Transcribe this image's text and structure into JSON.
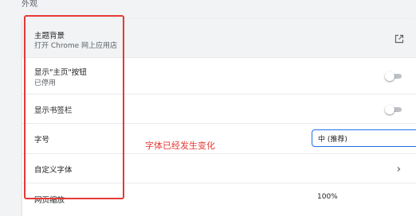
{
  "section": {
    "title": "外观"
  },
  "rows": {
    "theme": {
      "label": "主题背景",
      "sub": "打开 Chrome 网上应用店",
      "icon": "external-link-icon"
    },
    "home_button": {
      "label": "显示\"主页\"按钮",
      "sub": "已停用",
      "toggle_on": false
    },
    "bookmarks_bar": {
      "label": "显示书签栏",
      "toggle_on": false
    },
    "font_size": {
      "label": "字号",
      "value": "中 (推荐)"
    },
    "custom_fonts": {
      "label": "自定义字体",
      "icon": "chevron-right-icon"
    },
    "zoom": {
      "label": "网页缩放",
      "value": "100%"
    }
  },
  "annotation": {
    "text": "字体已经发生变化",
    "color": "#e53935"
  },
  "colors": {
    "accent": "#1a73e8",
    "toggle_track_off": "#bdc1c6"
  }
}
